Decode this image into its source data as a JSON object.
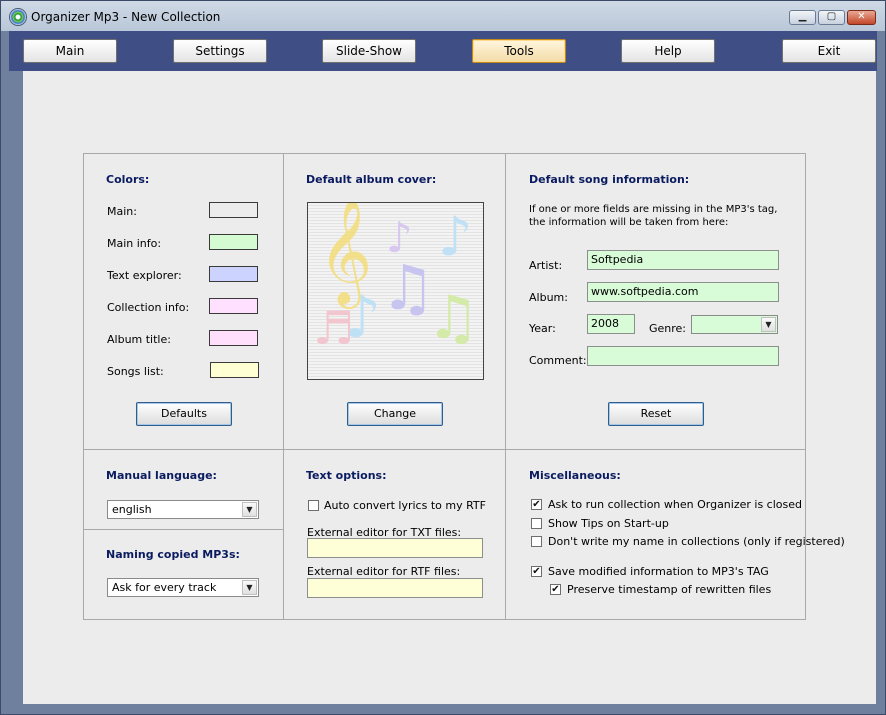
{
  "window": {
    "title": "Organizer Mp3 - New Collection",
    "minimize_glyph": "▁",
    "maximize_glyph": "▢",
    "close_glyph": "✕"
  },
  "nav": {
    "main": "Main",
    "settings": "Settings",
    "slideshow": "Slide-Show",
    "tools": "Tools",
    "help": "Help",
    "exit": "Exit",
    "active": "Tools"
  },
  "colors": {
    "heading": "Colors:",
    "items": [
      {
        "label": "Main:",
        "color": "#ececec"
      },
      {
        "label": "Main info:",
        "color": "#d5fbd2"
      },
      {
        "label": "Text explorer:",
        "color": "#ccd3ff"
      },
      {
        "label": "Collection info:",
        "color": "#ffe1ff"
      },
      {
        "label": "Album title:",
        "color": "#ffdffb"
      },
      {
        "label": "Songs list:",
        "color": "#ffffd4"
      }
    ],
    "defaults_button": "Defaults"
  },
  "album_cover": {
    "heading": "Default album cover:",
    "change_button": "Change"
  },
  "song_info": {
    "heading": "Default song information:",
    "description": "If one or more fields are missing in the MP3's tag, the information will be taken from here:",
    "artist_label": "Artist:",
    "artist_value": "Softpedia",
    "album_label": "Album:",
    "album_value": "www.softpedia.com",
    "year_label": "Year:",
    "year_value": "2008",
    "genre_label": "Genre:",
    "genre_value": "",
    "comment_label": "Comment:",
    "comment_value": "",
    "reset_button": "Reset"
  },
  "manual_language": {
    "heading": "Manual language:",
    "value": "english"
  },
  "naming": {
    "heading": "Naming copied MP3s:",
    "value": "Ask for every track"
  },
  "text_options": {
    "heading": "Text options:",
    "auto_convert_label": "Auto convert lyrics to my RTF",
    "auto_convert_checked": false,
    "txt_editor_label": "External editor for TXT files:",
    "txt_editor_value": "",
    "rtf_editor_label": "External editor for RTF files:",
    "rtf_editor_value": ""
  },
  "misc": {
    "heading": "Miscellaneous:",
    "options": [
      {
        "label": "Ask to run collection when Organizer is closed",
        "checked": true,
        "mark": "✔"
      },
      {
        "label": "Show Tips on Start-up",
        "checked": false,
        "mark": ""
      },
      {
        "label": "Don't write my name in collections (only if registered)",
        "checked": false,
        "mark": ""
      },
      {
        "label": "Save modified information to MP3's TAG",
        "checked": true,
        "mark": "✔"
      },
      {
        "label": "Preserve timestamp of rewritten files",
        "checked": true,
        "mark": "✔"
      }
    ]
  }
}
